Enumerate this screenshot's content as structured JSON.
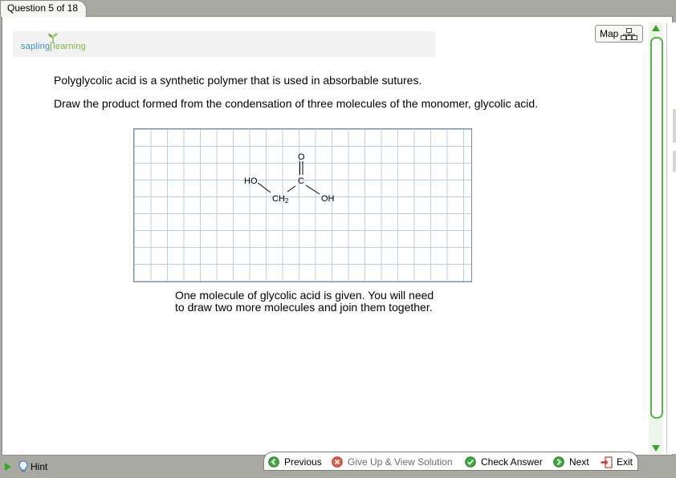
{
  "tab": {
    "label": "Question 5 of 18"
  },
  "logo": {
    "part1": "sapling",
    "part2": "learning"
  },
  "map": {
    "label": "Map"
  },
  "question": {
    "line1": "Polyglycolic acid is a synthetic polymer that is used in absorbable sutures.",
    "line2": "Draw the product formed from the condensation of three molecules of the monomer, glycolic acid."
  },
  "molecule": {
    "ho": "HO",
    "ch2": "CH",
    "ch2_sub": "2",
    "c": "C",
    "o": "O",
    "oh": "OH"
  },
  "note": {
    "line1": "One molecule of glycolic acid is given. You will need",
    "line2": "to draw two more molecules and join them together."
  },
  "hint": {
    "label": "Hint"
  },
  "nav": {
    "previous": "Previous",
    "giveup": "Give Up & View Solution",
    "check": "Check Answer",
    "next": "Next",
    "exit": "Exit"
  },
  "colors": {
    "accent_green": "#32a826",
    "logo_blue": "#3c8bbf",
    "logo_green": "#7bb341",
    "grid_line": "#b8cde6"
  }
}
